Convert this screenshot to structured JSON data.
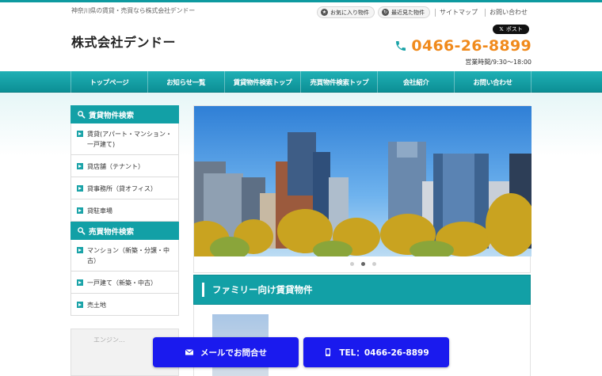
{
  "header": {
    "tagline": "神奈川県の賃貸・売買なら株式会社デンドー",
    "favorites_label": "お気に入り物件",
    "recent_label": "最近見た物件",
    "sitemap_label": "サイトマップ",
    "contact_label": "お問い合わせ",
    "company_name": "株式会社デンドー",
    "post_label": "ポスト",
    "phone": "0466-26-8899",
    "hours": "営業時間/9:30〜18:00"
  },
  "nav": {
    "items": [
      "トップページ",
      "お知らせ一覧",
      "賃貸物件検索トップ",
      "売買物件検索トップ",
      "会社紹介",
      "お問い合わせ"
    ]
  },
  "sidebar": {
    "rental_heading": "賃貸物件検索",
    "rental_items": [
      "賃貸(アパート・マンション・一戸建て)",
      "貸店舗（テナント）",
      "貸事務所（貸オフィス）",
      "貸駐車場"
    ],
    "sale_heading": "売買物件検索",
    "sale_items": [
      "マンション（新築・分譲・中古）",
      "一戸建て（新築・中古）",
      "売土地"
    ],
    "extra_title": "エンジン..."
  },
  "slider": {
    "slide_count": 3,
    "active_index": 1
  },
  "section": {
    "title": "ファミリー向け賃貸物件"
  },
  "cta": {
    "mail_label": "メールでお問合せ",
    "tel_label": "TEL：0466-26-8899"
  },
  "colors": {
    "teal": "#12a0a6",
    "orange": "#f08a1c",
    "cta_blue": "#1a1aee"
  }
}
